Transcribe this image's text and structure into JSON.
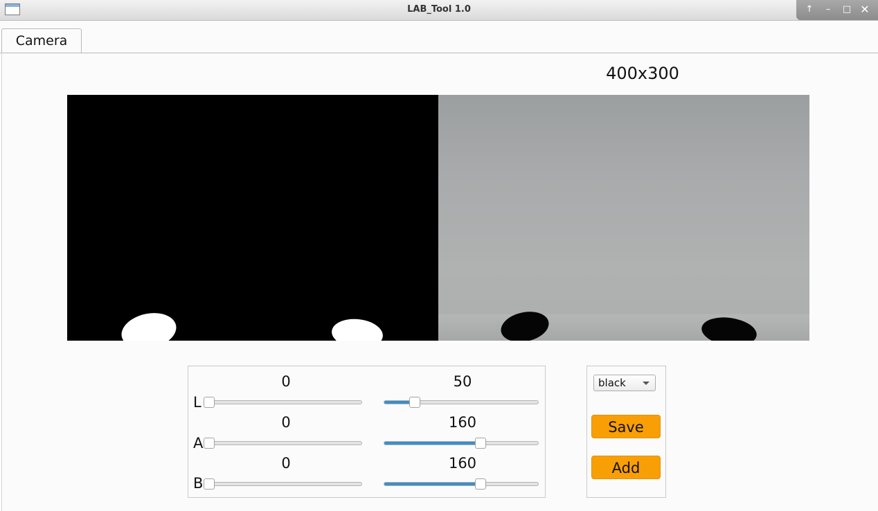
{
  "window": {
    "title": "LAB_Tool 1.0"
  },
  "tabs": [
    {
      "label": "Camera"
    }
  ],
  "camera": {
    "resolution": "400x300"
  },
  "sliders": [
    {
      "channel": "L",
      "min": 0,
      "max": 50
    },
    {
      "channel": "A",
      "min": 0,
      "max": 160
    },
    {
      "channel": "B",
      "min": 0,
      "max": 160
    }
  ],
  "slider_range": [
    0,
    255
  ],
  "controls": {
    "color_select": {
      "value": "black"
    },
    "save_label": "Save",
    "add_label": "Add"
  },
  "colors": {
    "accent_button": "#f99f06",
    "slider_fill": "#3d8ec8"
  }
}
